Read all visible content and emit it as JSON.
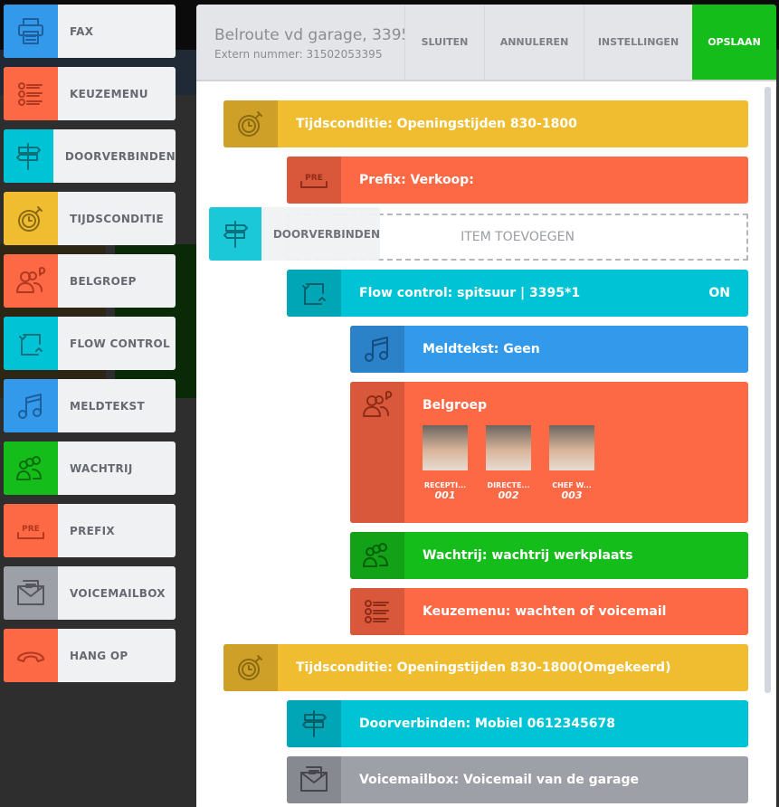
{
  "palette": [
    {
      "label": "FAX",
      "icon": "fax-icon",
      "color": "#3399ea",
      "ink": "#1d5f9c"
    },
    {
      "label": "KEUZEMENU",
      "icon": "menu-list-icon",
      "color": "#fd6845",
      "ink": "#b0391f"
    },
    {
      "label": "DOORVERBINDEN",
      "icon": "signpost-icon",
      "color": "#00c4d6",
      "ink": "#08727d"
    },
    {
      "label": "TIJDSCONDITIE",
      "icon": "stopwatch-icon",
      "color": "#f0bd30",
      "ink": "#8a6a12"
    },
    {
      "label": "BELGROEP",
      "icon": "group-icon",
      "color": "#fd6845",
      "ink": "#b0391f"
    },
    {
      "label": "FLOW CONTROL",
      "icon": "flow-icon",
      "color": "#00c4d6",
      "ink": "#08727d"
    },
    {
      "label": "MELDTEKST",
      "icon": "music-icon",
      "color": "#3399ea",
      "ink": "#1d5f9c"
    },
    {
      "label": "WACHTRIJ",
      "icon": "queue-icon",
      "color": "#15bd1b",
      "ink": "#0b6e0e"
    },
    {
      "label": "PREFIX",
      "icon": "prefix-icon",
      "color": "#fd6845",
      "ink": "#b0391f"
    },
    {
      "label": "VOICEMAILBOX",
      "icon": "voicemail-icon",
      "color": "#9ea0a8",
      "ink": "#55575d"
    },
    {
      "label": "HANG OP",
      "icon": "hangup-icon",
      "color": "#fd6845",
      "ink": "#b0391f"
    }
  ],
  "header": {
    "title": "Belroute vd garage, 3395",
    "subtitle": "Extern nummer:  31502053395",
    "buttons": [
      "SLUITEN",
      "ANNULEREN",
      "INSTELLINGEN"
    ],
    "save": "OPSLAAN",
    "save_color": "#15bd1b"
  },
  "drop": {
    "label": "ITEM TOEVOEGEN",
    "dragging": "DOORVERBINDEN"
  },
  "flow": [
    {
      "label": "Tijdsconditie: Openingstijden 830-1800",
      "icon": "stopwatch-icon",
      "color": "#f0bd30",
      "dark": "#cfa027",
      "ink": "#8a6a12"
    },
    {
      "label": "Prefix: Verkoop:",
      "icon": "prefix-icon",
      "color": "#fd6845",
      "dark": "#d9573a",
      "ink": "#8e2d17"
    },
    {
      "label": "Flow control: spitsuur | 3395*1",
      "status": "ON",
      "icon": "flow-icon",
      "color": "#00c4d6",
      "dark": "#00a6b5",
      "ink": "#05606a"
    },
    {
      "label": "Meldtekst: Geen",
      "icon": "music-icon",
      "color": "#3399ea",
      "dark": "#2b82c8",
      "ink": "#164d80"
    },
    {
      "label": "Belgroep",
      "icon": "group-icon",
      "color": "#fd6845",
      "dark": "#d9573a",
      "ink": "#8e2d17",
      "members": [
        {
          "name": "RECEPTI...",
          "ext": "001"
        },
        {
          "name": "DIRECTE...",
          "ext": "002"
        },
        {
          "name": "CHEF W...",
          "ext": "003"
        }
      ]
    },
    {
      "label": "Wachtrij: wachtrij werkplaats",
      "icon": "queue-icon",
      "color": "#15bd1b",
      "dark": "#12a117",
      "ink": "#075e0a"
    },
    {
      "label": "Keuzemenu: wachten of voicemail",
      "icon": "menu-list-icon",
      "color": "#fd6845",
      "dark": "#d9573a",
      "ink": "#8e2d17"
    },
    {
      "label": "Tijdsconditie: Openingstijden 830-1800(Omgekeerd)",
      "icon": "stopwatch-icon",
      "color": "#f0bd30",
      "dark": "#cfa027",
      "ink": "#8a6a12"
    },
    {
      "label": "Doorverbinden: Mobiel 0612345678",
      "icon": "signpost-icon",
      "color": "#00c4d6",
      "dark": "#00a6b5",
      "ink": "#05606a"
    },
    {
      "label": "Voicemailbox: Voicemail van de garage",
      "icon": "voicemail-icon",
      "color": "#9ea0a8",
      "dark": "#878991",
      "ink": "#45474c"
    }
  ]
}
